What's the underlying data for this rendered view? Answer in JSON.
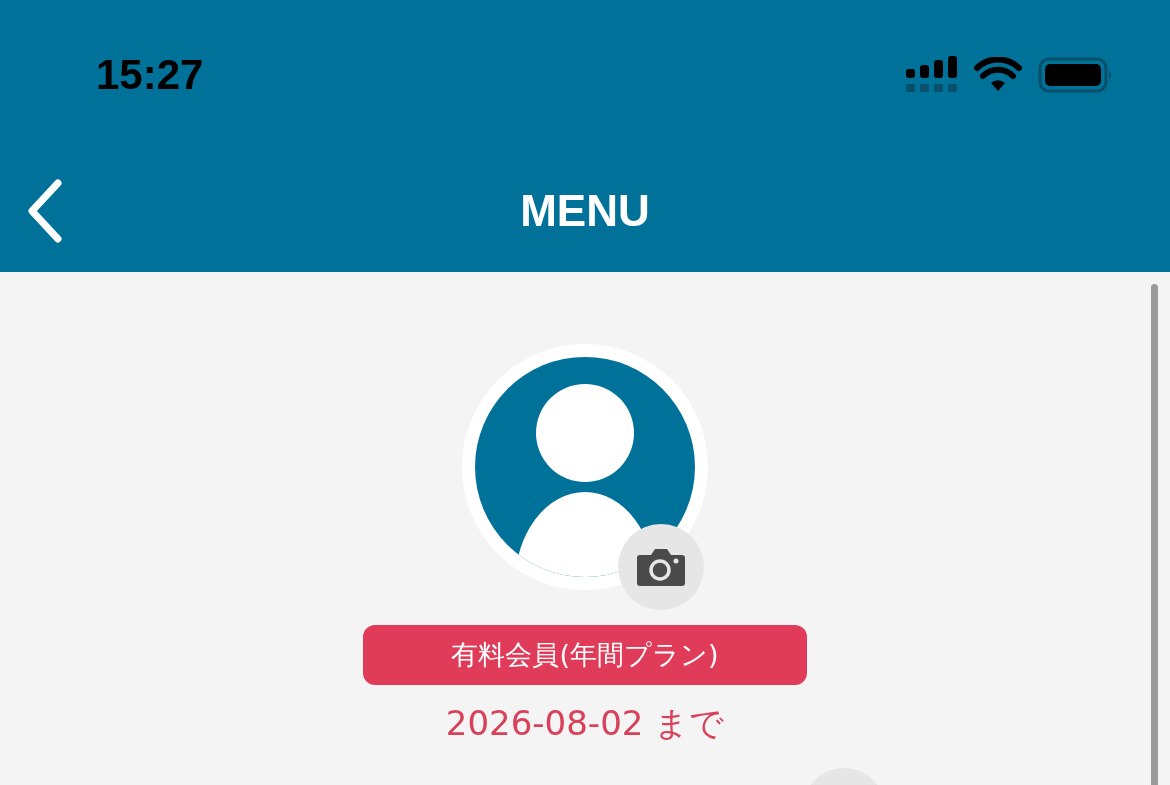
{
  "status_bar": {
    "time": "15:27"
  },
  "nav_bar": {
    "title": "MENU"
  },
  "profile": {
    "membership": "有料会員(年間プラン)",
    "expiry": "2026-08-02 まで"
  }
}
